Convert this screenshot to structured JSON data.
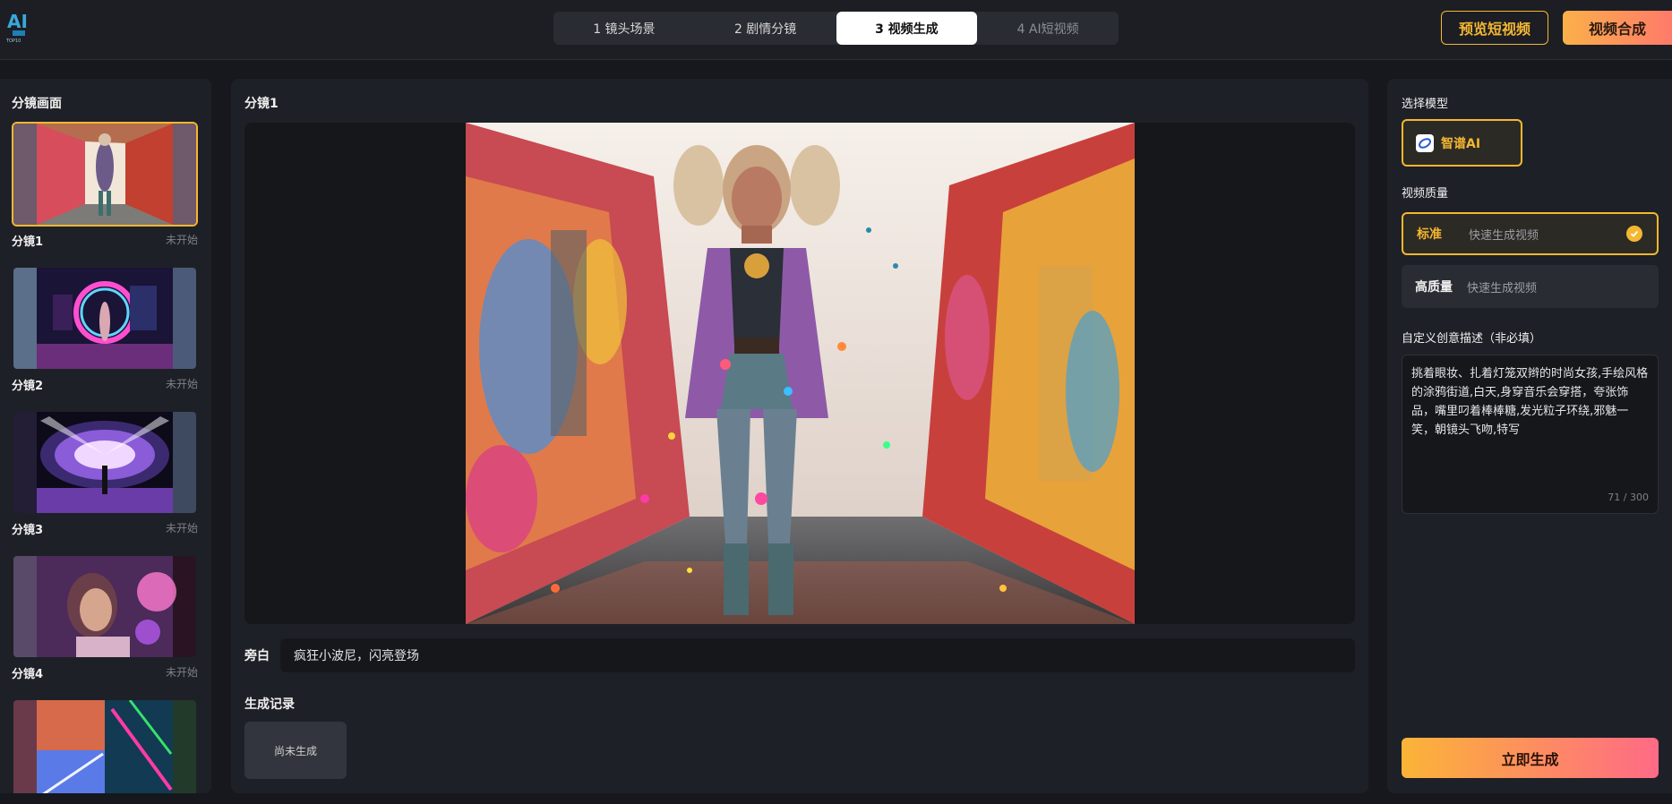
{
  "header": {
    "steps": [
      {
        "label": "1 镜头场景"
      },
      {
        "label": "2 剧情分镜"
      },
      {
        "label": "3 视频生成"
      },
      {
        "label": "4 AI短视频"
      }
    ],
    "preview_button": "预览短视频",
    "compose_button": "视频合成"
  },
  "left_panel": {
    "title": "分镜画面",
    "shots": [
      {
        "name": "分镜1",
        "status": "未开始"
      },
      {
        "name": "分镜2",
        "status": "未开始"
      },
      {
        "name": "分镜3",
        "status": "未开始"
      },
      {
        "name": "分镜4",
        "status": "未开始"
      },
      {
        "name": "",
        "status": ""
      }
    ]
  },
  "center": {
    "shot_title": "分镜1",
    "narration_label": "旁白",
    "narration_text": "疯狂小波尼，闪亮登场",
    "history_title": "生成记录",
    "history_empty": "尚未生成"
  },
  "right_panel": {
    "model_title": "选择模型",
    "model_name": "智谱AI",
    "quality_title": "视频质量",
    "qualities": [
      {
        "name": "标准",
        "desc": "快速生成视频"
      },
      {
        "name": "高质量",
        "desc": "快速生成视频"
      }
    ],
    "desc_title": "自定义创意描述（非必填）",
    "desc_text": "挑着眼妆、扎着灯笼双辫的时尚女孩,手绘风格的涂鸦街道,白天,身穿音乐会穿搭，夸张饰品，嘴里叼着棒棒糖,发光粒子环绕,邪魅一笑，朝镜头飞吻,特写",
    "desc_count": "71 / 300",
    "generate_button": "立即生成"
  },
  "colors": {
    "accent": "#f5b731",
    "gradient_start": "#fbb437",
    "gradient_end": "#ff6a86"
  }
}
